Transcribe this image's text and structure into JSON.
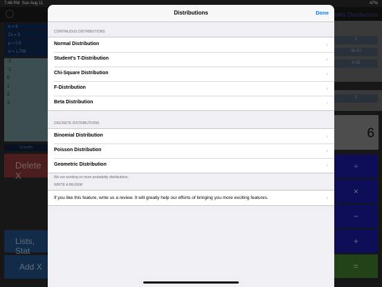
{
  "status_bar": {
    "time": "7:48 PM",
    "date": "Sun Aug 11",
    "battery": "47%"
  },
  "background": {
    "title_right": "bability Distributions",
    "stats": [
      "n = 6",
      "Σx = 3",
      "μ = 0.5",
      "σ = 1.708"
    ],
    "list_values": [
      "-2",
      "-1",
      "0",
      "1",
      "2",
      "3"
    ],
    "scientific_tab": "Scientific",
    "delete_label": "Delete X",
    "lists_label": "Lists, Stat",
    "add_label": "Add X",
    "right_values": [
      "1",
      "36.87",
      "4.33",
      "2"
    ],
    "display_value": "6",
    "operators": [
      "÷",
      "×",
      "−",
      "+",
      "="
    ]
  },
  "modal": {
    "title": "Distributions",
    "done_label": "Done",
    "continuous_header": "CONTINUOUS DISTRIBUTIONS",
    "continuous_items": [
      "Normal Distribution",
      "Student's T-Distribution",
      "Chi-Square Distribution",
      "F-Distribution",
      "Beta Distribution"
    ],
    "discrete_header": "DISCRETE DISTRIBUTIONS",
    "discrete_items": [
      "Binomial Distribution",
      "Poisson Distribution",
      "Geometric Distribution"
    ],
    "discrete_footer": "We are working on more probability distributions.",
    "review_header": "WRITE A REVIEW",
    "review_text": "If you like this feature, write us a review. It will greatly help our efforts of bringing you more exciting features."
  },
  "icons": {
    "chevron": "chevron-right-icon",
    "settings": "gear-icon"
  },
  "colors": {
    "accent": "#007aff",
    "delete": "#8a3637",
    "operator": "#1a1aa0",
    "equals": "#3f7a2a"
  }
}
